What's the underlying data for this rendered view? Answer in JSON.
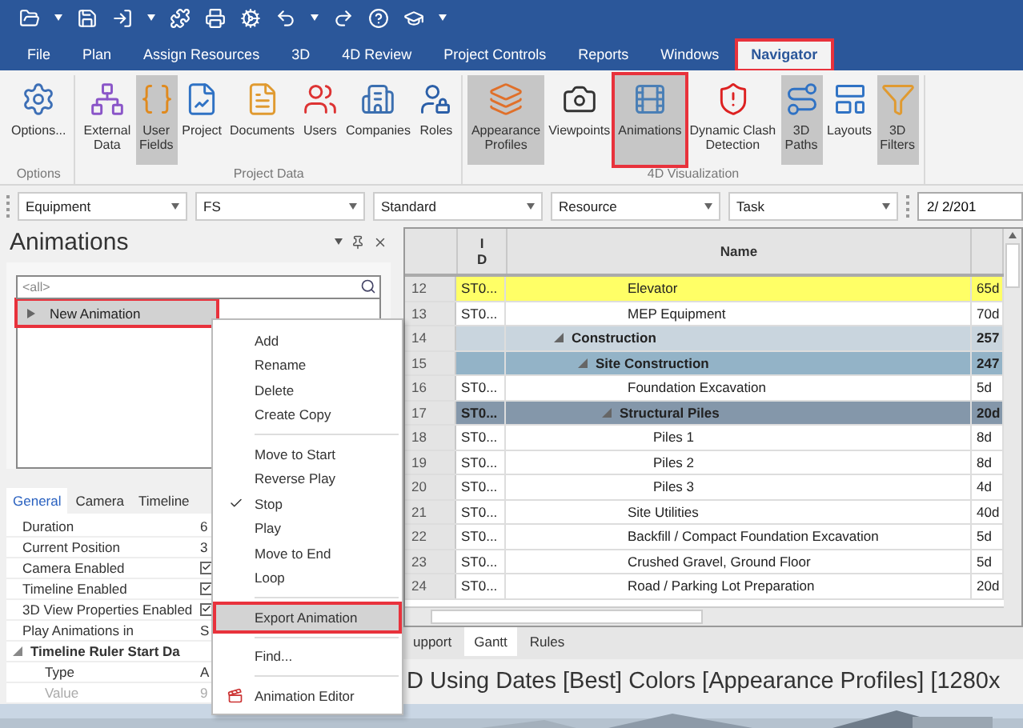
{
  "menu_tabs": [
    {
      "label": "File",
      "selected": false,
      "outlined": false
    },
    {
      "label": "Plan",
      "selected": false,
      "outlined": false
    },
    {
      "label": "Assign Resources",
      "selected": false,
      "outlined": false
    },
    {
      "label": "3D",
      "selected": false,
      "outlined": false
    },
    {
      "label": "4D Review",
      "selected": false,
      "outlined": false
    },
    {
      "label": "Project Controls",
      "selected": false,
      "outlined": false
    },
    {
      "label": "Reports",
      "selected": false,
      "outlined": false
    },
    {
      "label": "Windows",
      "selected": false,
      "outlined": false
    },
    {
      "label": "Navigator",
      "selected": true,
      "outlined": true
    }
  ],
  "ribbon": {
    "groups": [
      {
        "label": "Options",
        "buttons": [
          {
            "lines": [
              "Options..."
            ],
            "selected": false,
            "outlined": false
          }
        ]
      },
      {
        "label": "Project Data",
        "buttons": [
          {
            "lines": [
              "External",
              "Data"
            ],
            "selected": false,
            "outlined": false
          },
          {
            "lines": [
              "User",
              "Fields"
            ],
            "selected": true,
            "outlined": false
          },
          {
            "lines": [
              "Project"
            ],
            "selected": false,
            "outlined": false
          },
          {
            "lines": [
              "Documents"
            ],
            "selected": false,
            "outlined": false
          },
          {
            "lines": [
              "Users"
            ],
            "selected": false,
            "outlined": false
          },
          {
            "lines": [
              "Companies"
            ],
            "selected": false,
            "outlined": false
          },
          {
            "lines": [
              "Roles"
            ],
            "selected": false,
            "outlined": false
          }
        ]
      },
      {
        "label": "4D Visualization",
        "buttons": [
          {
            "lines": [
              "Appearance",
              "Profiles"
            ],
            "selected": true,
            "outlined": false
          },
          {
            "lines": [
              "Viewpoints"
            ],
            "selected": false,
            "outlined": false
          },
          {
            "lines": [
              "Animations"
            ],
            "selected": true,
            "outlined": true
          },
          {
            "lines": [
              "Dynamic Clash",
              "Detection"
            ],
            "selected": false,
            "outlined": false
          },
          {
            "lines": [
              "3D",
              "Paths"
            ],
            "selected": true,
            "outlined": false
          },
          {
            "lines": [
              "Layouts"
            ],
            "selected": false,
            "outlined": false
          },
          {
            "lines": [
              "3D",
              "Filters"
            ],
            "selected": true,
            "outlined": false
          }
        ]
      }
    ]
  },
  "filter_bar": {
    "dropdowns": [
      {
        "value": "Equipment"
      },
      {
        "value": "FS"
      },
      {
        "value": "Standard"
      },
      {
        "value": "Resource"
      },
      {
        "value": "Task"
      }
    ],
    "date": "2/ 2/201"
  },
  "animations_panel": {
    "title": "Animations",
    "search": {
      "placeholder": "<all>"
    },
    "items": [
      {
        "label": "New Animation",
        "expanded": false,
        "selected": true,
        "outlined": true
      }
    ],
    "tabs": [
      {
        "label": "General",
        "selected": true
      },
      {
        "label": "Camera",
        "selected": false
      },
      {
        "label": "Timeline",
        "selected": false
      }
    ],
    "properties": [
      {
        "kind": "text",
        "name": "Duration",
        "value": "6"
      },
      {
        "kind": "text",
        "name": "Current Position",
        "value": "3"
      },
      {
        "kind": "checkbox",
        "name": "Camera Enabled",
        "checked": true
      },
      {
        "kind": "checkbox",
        "name": "Timeline Enabled",
        "checked": true
      },
      {
        "kind": "checkbox",
        "name": "3D View Properties Enabled",
        "checked": true
      },
      {
        "kind": "text",
        "name": "Play Animations in",
        "value": "S"
      },
      {
        "kind": "group",
        "name": "Timeline Ruler Start Da",
        "expanded": true,
        "children": [
          {
            "kind": "text",
            "name": "Type",
            "value": "A",
            "disabled": false
          },
          {
            "kind": "text",
            "name": "Value",
            "value": "9",
            "disabled": true
          }
        ]
      }
    ]
  },
  "context_menu": {
    "groups": [
      [
        {
          "label": "Add",
          "kind": "plain",
          "checked": false,
          "highlighted": false
        },
        {
          "label": "Rename",
          "kind": "plain",
          "checked": false,
          "highlighted": false
        },
        {
          "label": "Delete",
          "kind": "plain",
          "checked": false,
          "highlighted": false
        },
        {
          "label": "Create Copy",
          "kind": "plain",
          "checked": false,
          "highlighted": false
        }
      ],
      [
        {
          "label": "Move to Start",
          "kind": "plain",
          "checked": false,
          "highlighted": false
        },
        {
          "label": "Reverse Play",
          "kind": "plain",
          "checked": false,
          "highlighted": false
        },
        {
          "label": "Stop",
          "kind": "plain",
          "checked": true,
          "highlighted": false
        },
        {
          "label": "Play",
          "kind": "plain",
          "checked": false,
          "highlighted": false
        },
        {
          "label": "Move to End",
          "kind": "plain",
          "checked": false,
          "highlighted": false
        },
        {
          "label": "Loop",
          "kind": "plain",
          "checked": false,
          "highlighted": false
        }
      ],
      [
        {
          "label": "Export Animation",
          "kind": "plain",
          "checked": false,
          "highlighted": true
        }
      ],
      [
        {
          "label": "Find...",
          "kind": "plain",
          "checked": false,
          "highlighted": false
        }
      ],
      [
        {
          "label": "Animation Editor",
          "kind": "with_icon",
          "checked": false,
          "highlighted": false
        }
      ]
    ]
  },
  "table": {
    "columns": [
      {
        "label": "ID"
      },
      {
        "label": "Name"
      }
    ],
    "rows": [
      {
        "num": "12",
        "id": "ST0...",
        "name": "Elevator",
        "column_4": "65d",
        "color": "#ffff66"
      },
      {
        "num": "13",
        "id": "ST0...",
        "name": "MEP Equipment",
        "column_4": "70d",
        "color": "#ffffff"
      },
      {
        "num": "14",
        "name": "Construction",
        "column_4": "257",
        "color": "#c9d5de",
        "expanded": true,
        "children": [
          {
            "num": "15",
            "name": "Site Construction",
            "column_4": "247",
            "color": "#93b3c7",
            "expanded": true,
            "children": [
              {
                "num": "16",
                "id": "ST0...",
                "name": "Foundation Excavation",
                "column_4": "5d",
                "color": "#ffffff"
              },
              {
                "num": "17",
                "id": "ST0...",
                "name": "Structural Piles",
                "column_4": "20d",
                "color": "#8497aa",
                "expanded": true,
                "children": [
                  {
                    "num": "18",
                    "id": "ST0...",
                    "name": "Piles 1",
                    "column_4": "8d",
                    "color": "#ffffff"
                  },
                  {
                    "num": "19",
                    "id": "ST0...",
                    "name": "Piles 2",
                    "column_4": "8d",
                    "color": "#ffffff"
                  },
                  {
                    "num": "20",
                    "id": "ST0...",
                    "name": "Piles 3",
                    "column_4": "4d",
                    "color": "#ffffff"
                  }
                ]
              },
              {
                "num": "21",
                "id": "ST0...",
                "name": "Site Utilities",
                "column_4": "40d",
                "color": "#ffffff"
              },
              {
                "num": "22",
                "id": "ST0...",
                "name": "Backfill / Compact  Foundation Excavation",
                "column_4": "5d",
                "color": "#ffffff"
              },
              {
                "num": "23",
                "id": "ST0...",
                "name": "Crushed Gravel, Ground Floor",
                "column_4": "5d",
                "color": "#ffffff"
              },
              {
                "num": "24",
                "id": "ST0...",
                "name": "Road / Parking Lot Preparation",
                "column_4": "20d",
                "color": "#ffffff"
              }
            ]
          }
        ]
      }
    ]
  },
  "bottom_tabs": [
    {
      "label": "upport",
      "selected": false
    },
    {
      "label": "Gantt",
      "selected": true
    },
    {
      "label": "Rules",
      "selected": false
    }
  ],
  "status_line": "D Using Dates [Best] Colors [Appearance Profiles]  [1280x"
}
